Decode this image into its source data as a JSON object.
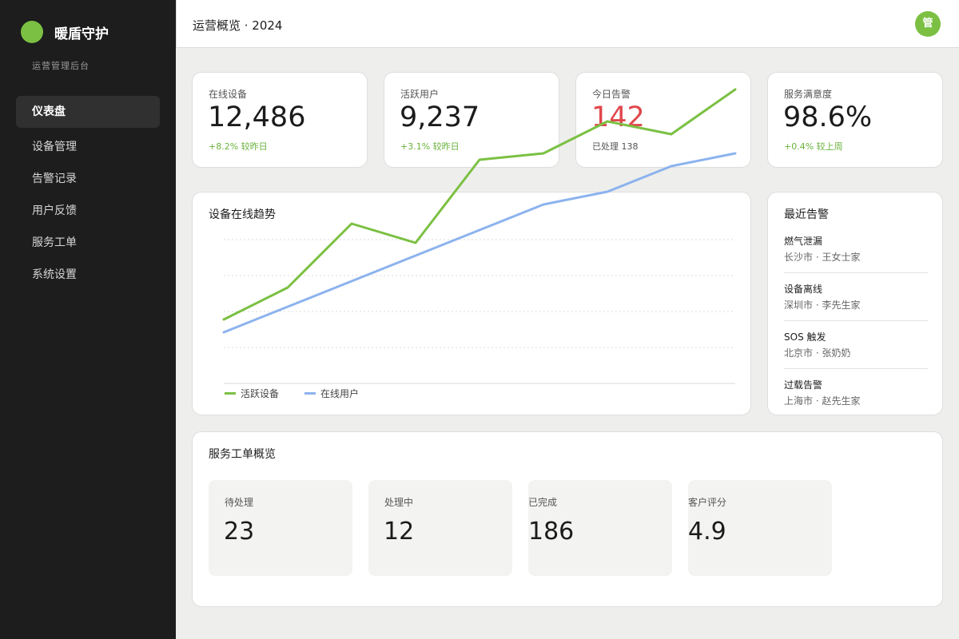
{
  "brand": {
    "name": "暖盾守护",
    "subtitle": "运营管理后台"
  },
  "nav": [
    {
      "label": "仪表盘",
      "active": true
    },
    {
      "label": "设备管理"
    },
    {
      "label": "告警记录"
    },
    {
      "label": "用户反馈"
    },
    {
      "label": "服务工单"
    },
    {
      "label": "系统设置"
    }
  ],
  "header": {
    "title": "运营概览 · 2024",
    "avatar_text": "管"
  },
  "stats": [
    {
      "label": "在线设备",
      "value": "12,486",
      "delta": "+8.2% 较昨日"
    },
    {
      "label": "活跃用户",
      "value": "9,237",
      "delta": "+3.1% 较昨日"
    },
    {
      "label": "今日告警",
      "value": "142",
      "delta": "已处理 138"
    },
    {
      "label": "服务满意度",
      "value": "98.6%",
      "delta": "+0.4% 较上周"
    }
  ],
  "trend": {
    "title": "设备在线趋势",
    "chart_data": {
      "type": "line",
      "x": [
        1,
        2,
        3,
        4,
        5,
        6,
        7,
        8,
        9
      ],
      "series": [
        {
          "name": "活跃设备",
          "color": "#7bc043",
          "values": [
            2,
            3,
            5,
            4.4,
            7,
            7.2,
            8.2,
            7.8,
            9.2
          ]
        },
        {
          "name": "在线用户",
          "color": "#8cb3ee",
          "values": [
            1.6,
            2.4,
            3.2,
            4,
            4.8,
            5.6,
            6,
            6.8,
            7.2
          ]
        }
      ],
      "ylim": [
        0,
        8.8
      ],
      "grid": true,
      "legend": "bottom-left"
    }
  },
  "alerts": {
    "title": "最近告警",
    "items": [
      {
        "name": "燃气泄漏",
        "location": "长沙市 · 王女士家"
      },
      {
        "name": "设备离线",
        "location": "深圳市 · 李先生家"
      },
      {
        "name": "SOS 触发",
        "location": "北京市 · 张奶奶"
      },
      {
        "name": "过载告警",
        "location": "上海市 · 赵先生家"
      }
    ]
  },
  "tickets": {
    "title": "服务工单概览",
    "items": [
      {
        "label": "待处理",
        "value": "23"
      },
      {
        "label": "处理中",
        "value": "12"
      },
      {
        "label": "已完成",
        "value": "186"
      },
      {
        "label": "客户评分",
        "value": "4.9"
      }
    ]
  }
}
